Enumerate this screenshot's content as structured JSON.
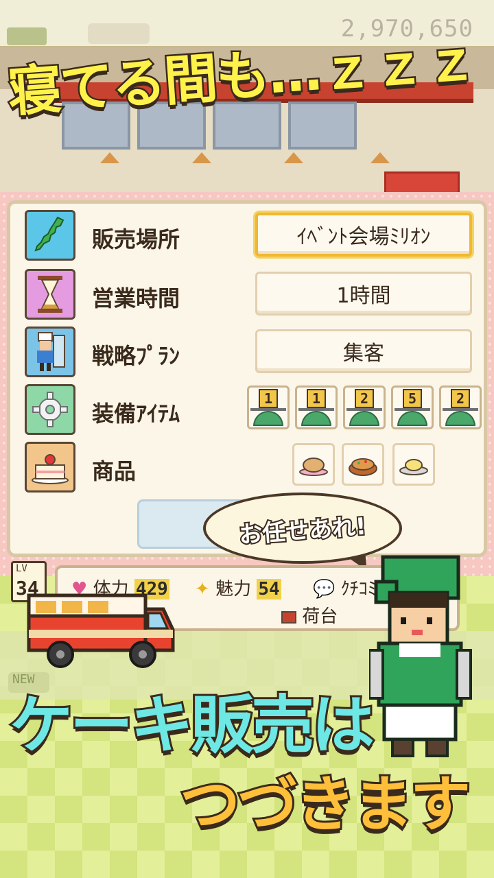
{
  "top_bar": {
    "money": "2,970,650"
  },
  "headline": "寝てる間も…ｚｚｚ",
  "settings": {
    "rows": [
      {
        "label": "販売場所",
        "value": "ｲﾍﾞﾝﾄ会場ﾐﾘｵﾝ",
        "icon": "japan-map-icon"
      },
      {
        "label": "営業時間",
        "value": "1時間",
        "icon": "hourglass-icon"
      },
      {
        "label": "戦略ﾌﾟﾗﾝ",
        "value": "集客",
        "icon": "chef-icon"
      },
      {
        "label": "装備ｱｲﾃﾑ",
        "icon": "gear-icon"
      },
      {
        "label": "商品",
        "icon": "cake-icon"
      }
    ],
    "equipment_levels": [
      "1",
      "1",
      "2",
      "5",
      "2"
    ],
    "products": [
      "bread-bowl",
      "pie-dish",
      "custard-cup"
    ]
  },
  "speech_bubble": "お任せあれ!",
  "status": {
    "lv_label": "LV",
    "lv_value": "34",
    "hp_label": "体力",
    "hp_value": "429",
    "charm_label": "魅力",
    "charm_value": "54",
    "review_label": "ｸﾁｺﾐ",
    "cargo_label": "荷台"
  },
  "new_label": "NEW",
  "bottom_line1": "ケーキ販売は",
  "bottom_line2": "つづきます",
  "colors": {
    "headline": "#fff24a",
    "bottom_line1": "#6ee8e4",
    "bottom_line2": "#ffbf3a",
    "panel_pink": "#f7c7c2",
    "selected_border": "#f0b830"
  }
}
